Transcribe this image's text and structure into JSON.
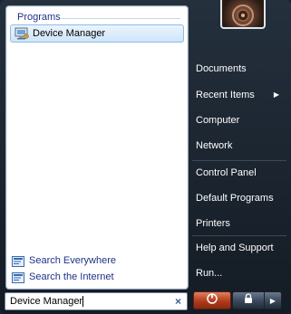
{
  "programs": {
    "header": "Programs",
    "items": [
      {
        "label": "Device Manager",
        "icon": "device-manager-icon"
      }
    ]
  },
  "search_links": [
    {
      "label": "Search Everywhere",
      "icon": "search-everywhere-icon"
    },
    {
      "label": "Search the Internet",
      "icon": "search-internet-icon"
    }
  ],
  "search": {
    "value": "Device Manager",
    "clear_symbol": "×"
  },
  "right_menu": {
    "items": [
      {
        "label": "Documents"
      },
      {
        "label": "Recent Items",
        "submenu_arrow": "▶"
      },
      {
        "label": "Computer"
      },
      {
        "label": "Network"
      },
      {
        "label": "Control Panel"
      },
      {
        "label": "Default Programs"
      },
      {
        "label": "Printers"
      },
      {
        "label": "Help and Support"
      },
      {
        "label": "Run..."
      }
    ]
  },
  "buttons": {
    "power": "power-icon",
    "lock": "lock-icon",
    "more_arrow": "▶"
  },
  "colors": {
    "link_blue": "#1e3287",
    "highlight": "#cfe5fa",
    "panel_dark": "#1b2430",
    "power_red": "#b23a1a"
  }
}
